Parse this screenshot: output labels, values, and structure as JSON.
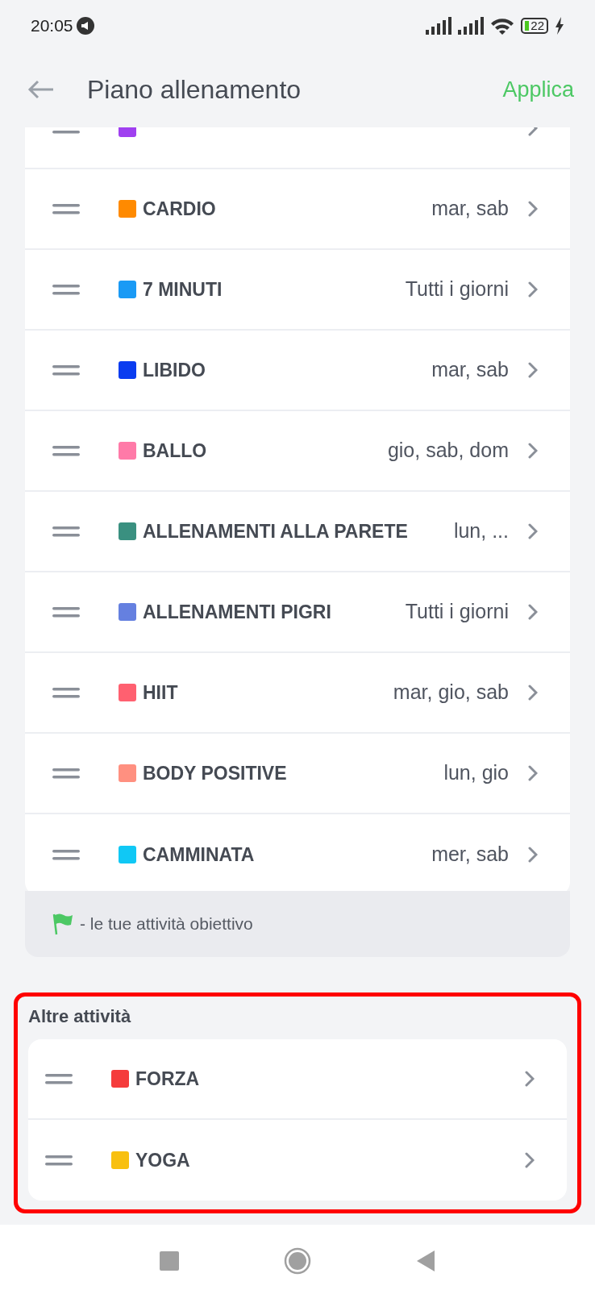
{
  "status_bar": {
    "time": "20:05",
    "battery": "22"
  },
  "header": {
    "title": "Piano allenamento",
    "action": "Applica"
  },
  "plan": {
    "items": [
      {
        "color": "#a040f0"
      },
      {
        "name": "CARDIO",
        "days": "mar, sab",
        "color": "#ff8a00"
      },
      {
        "name": "7 MINUTI",
        "days": "Tutti i giorni",
        "color": "#1a9af5"
      },
      {
        "name": "LIBIDO",
        "days": "mar, sab",
        "color": "#0a3cf0"
      },
      {
        "name": "BALLO",
        "days": "gio, sab, dom",
        "color": "#ff7aa8"
      },
      {
        "name": "ALLENAMENTI ALLA PARETE",
        "days": "lun, ...",
        "color": "#3a9080"
      },
      {
        "name": "ALLENAMENTI PIGRI",
        "days": "Tutti i giorni",
        "color": "#6580e0"
      },
      {
        "name": "HIIT",
        "days": "mar, gio, sab",
        "color": "#ff6070"
      },
      {
        "name": "BODY POSITIVE",
        "days": "lun, gio",
        "color": "#ff9080"
      },
      {
        "name": "CAMMINATA",
        "days": "mer, sab",
        "color": "#10c8f5"
      }
    ],
    "legend": "- le tue attività obiettivo"
  },
  "other": {
    "title": "Altre attività",
    "highlighted": true,
    "items": [
      {
        "name": "FORZA",
        "color": "#f53c3c"
      },
      {
        "name": "YOGA",
        "color": "#f8c010"
      }
    ]
  }
}
